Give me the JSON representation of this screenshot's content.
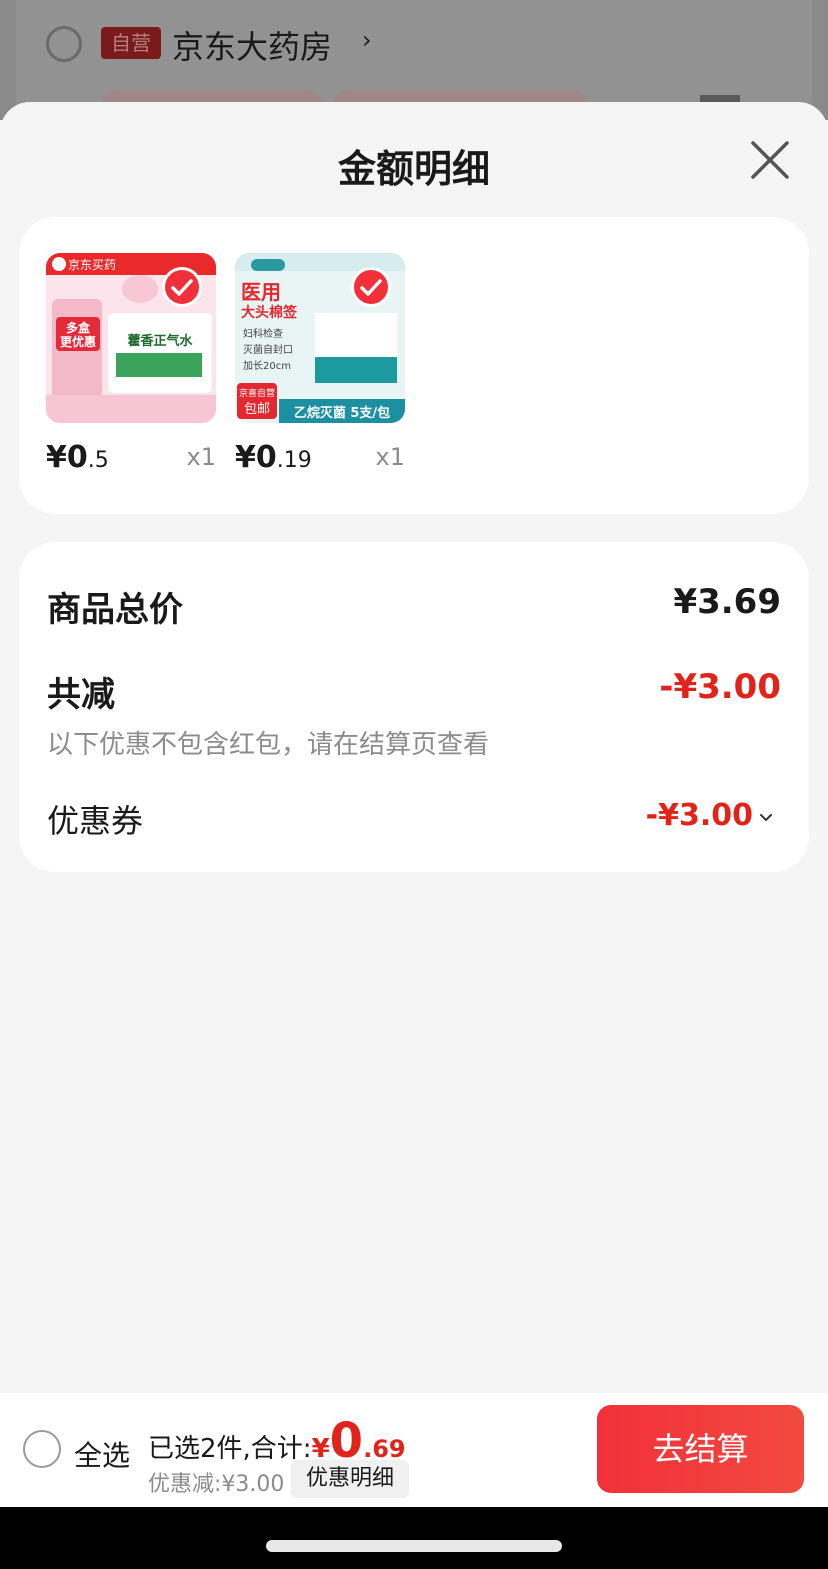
{
  "background_store": {
    "badge": "自营",
    "name": "京东大药房"
  },
  "sheet": {
    "title": "金额明细"
  },
  "products": [
    {
      "name": "藿香正气水",
      "thumb_brand": "京东买药",
      "thumb_lines": [
        "多盒",
        "更优惠"
      ],
      "price_int": "¥0",
      "price_dec": ".5",
      "qty": "x1"
    },
    {
      "name": "医用大头棉签",
      "thumb_lines": [
        "医用",
        "大头棉签",
        "妇科检查",
        "灭菌自封口",
        "加长20cm"
      ],
      "thumb_tag_top": "京喜自营",
      "thumb_tag": "包邮",
      "thumb_bottom": "乙烷灭菌 5支/包",
      "price_int": "¥0",
      "price_dec": ".19",
      "qty": "x1"
    }
  ],
  "summary": {
    "total_label": "商品总价",
    "total_value": "¥3.69",
    "reduction_label": "共减",
    "reduction_value": "-¥3.00",
    "note": "以下优惠不包含红包，请在结算页查看",
    "coupon_label": "优惠券",
    "coupon_value": "-¥3.00"
  },
  "bottom_bar": {
    "select_all": "全选",
    "selected_prefix": "已选2件,合计:",
    "total_yen": "¥",
    "total_big": "0",
    "total_small": ".69",
    "discount": "优惠减:¥3.00",
    "detail_button": "优惠明细",
    "checkout_button": "去结算"
  },
  "colors": {
    "accent_red": "#e2231a",
    "button_red": "#f2303a"
  }
}
